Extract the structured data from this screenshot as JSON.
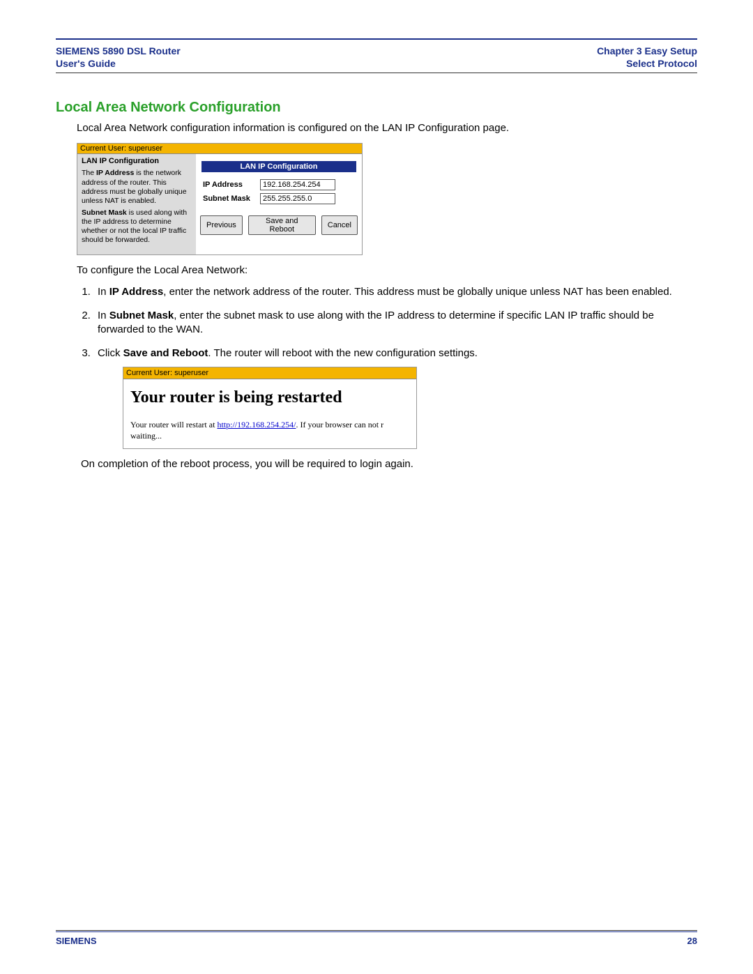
{
  "header": {
    "left_line1": "SIEMENS 5890 DSL Router",
    "left_line2": "User's Guide",
    "right_line1": "Chapter 3  Easy Setup",
    "right_line2": "Select Protocol"
  },
  "section_title": "Local Area Network Configuration",
  "intro": "Local Area Network configuration information is configured on the LAN IP Configuration page.",
  "fig1": {
    "userbar": "Current User: superuser",
    "sidebar": {
      "title": "LAN IP Configuration",
      "para1_a": "The ",
      "para1_b": "IP Address",
      "para1_c": " is the network address of the router. This address must be globally unique unless NAT is enabled.",
      "para2_a": "Subnet Mask",
      "para2_b": " is used along with the IP address to determine whether or not the local IP traffic should be forwarded."
    },
    "bluebar": "LAN IP Configuration",
    "ip_label": "IP Address",
    "ip_value": "192.168.254.254",
    "mask_label": "Subnet Mask",
    "mask_value": "255.255.255.0",
    "btn_prev": "Previous",
    "btn_save": "Save and Reboot",
    "btn_cancel": "Cancel"
  },
  "steps_intro": "To configure the Local Area Network:",
  "steps": {
    "s1_a": "In ",
    "s1_b": "IP Address",
    "s1_c": ", enter the network address of the router. This address must be globally unique unless NAT has been enabled.",
    "s2_a": "In ",
    "s2_b": "Subnet Mask",
    "s2_c": ", enter the subnet mask to use along with the IP address to determine if specific LAN IP traffic should be forwarded to the WAN.",
    "s3_a": "Click ",
    "s3_b": "Save and Reboot",
    "s3_c": ". The router will reboot with the new configuration settings."
  },
  "fig2": {
    "userbar": "Current User: superuser",
    "title": "Your router is being restarted",
    "pre": "Your router will restart at ",
    "link": "http://192.168.254.254/",
    "post": ". If your browser can not r",
    "waiting": "waiting..."
  },
  "post_fig2": "On completion of the reboot process, you will be required to login again.",
  "footer": {
    "brand": "SIEMENS",
    "page": "28"
  }
}
